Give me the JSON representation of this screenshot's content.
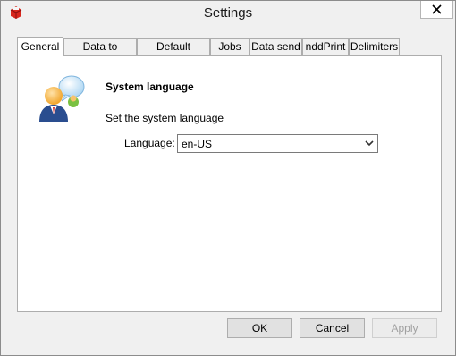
{
  "window": {
    "title": "Settings",
    "app_icon": "red-printer-icon",
    "close_icon": "close-icon"
  },
  "tabs": [
    {
      "label": "General",
      "active": true
    },
    {
      "label": "Data to printers",
      "active": false
    },
    {
      "label": "Default domain",
      "active": false
    },
    {
      "label": "Jobs",
      "active": false
    },
    {
      "label": "Data send",
      "active": false
    },
    {
      "label": "nddPrint",
      "active": false
    },
    {
      "label": "Delimiters",
      "active": false
    }
  ],
  "general": {
    "icon": "user-speech-bubble-icon",
    "section_title": "System language",
    "description": "Set the system language",
    "language_label": "Language:",
    "language_value": "en-US"
  },
  "buttons": {
    "ok": "OK",
    "cancel": "Cancel",
    "apply": "Apply"
  },
  "colors": {
    "window_bg": "#f0f0f0",
    "panel_bg": "#ffffff",
    "border": "#adadad",
    "disabled_text": "#a0a0a0"
  }
}
